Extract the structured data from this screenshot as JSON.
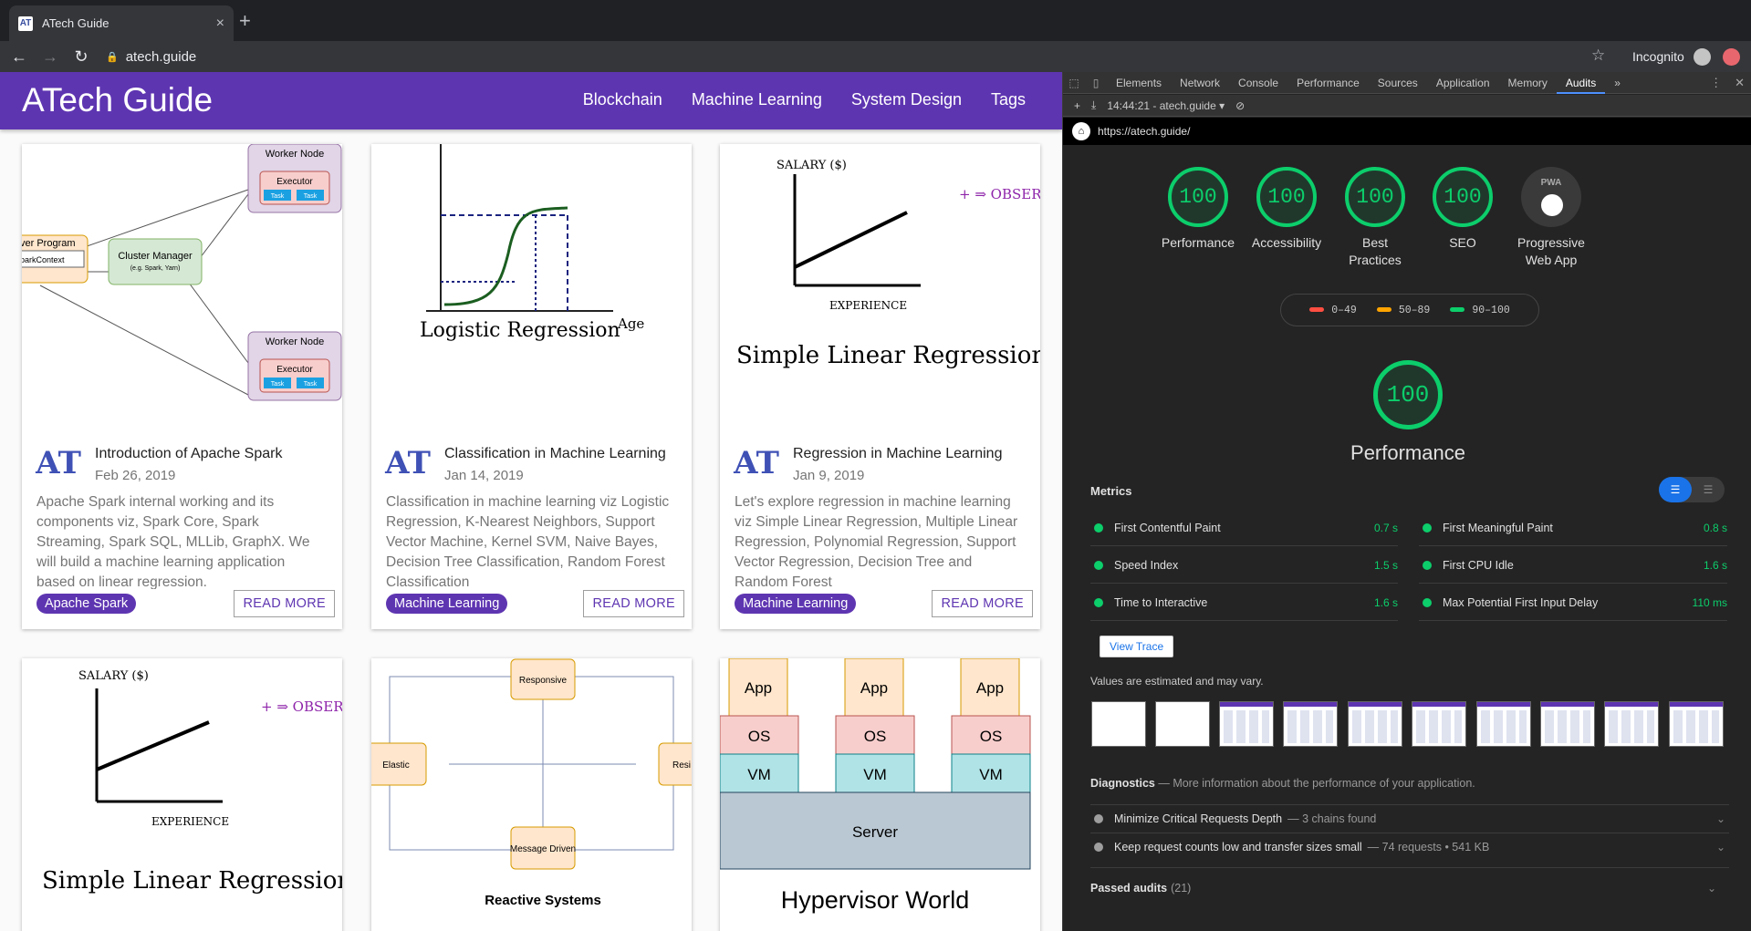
{
  "browser": {
    "tab_title": "ATech Guide",
    "tab_favicon": "AT",
    "close_glyph": "×",
    "newtab_glyph": "+",
    "url": "atech.guide",
    "profile_label": "Incognito",
    "lock_glyph": "🔒",
    "back_glyph": "←",
    "forward_glyph": "→",
    "reload_glyph": "↻",
    "star_glyph": "☆"
  },
  "site": {
    "brand": "ATech Guide",
    "nav": [
      "Blockchain",
      "Machine Learning",
      "System Design",
      "Tags"
    ],
    "logo_text": "AT",
    "cards": [
      {
        "image_title": "",
        "title": "Introduction of Apache Spark",
        "date": "Feb 26, 2019",
        "description": "Apache Spark internal working and its components viz, Spark Core, Spark Streaming, Spark SQL, MLLib, GraphX. We will build a machine learning application based on linear regression.",
        "tag": "Apache Spark",
        "more": "READ MORE",
        "diagram": {
          "worker_node": "Worker Node",
          "executor": "Executor",
          "task": "Task",
          "driver": "ver Program",
          "context": "parkContext",
          "cluster_manager": "Cluster Manager",
          "cluster_sub": "(e.g. Spark, Yarn)"
        }
      },
      {
        "image_title": "Logistic Regression",
        "title": "Classification in Machine Learning",
        "date": "Jan 14, 2019",
        "description": "Classification in machine learning viz Logistic Regression, K-Nearest Neighbors, Support Vector Machine, Kernel SVM, Naive Bayes, Decision Tree Classification, Random Forest Classification",
        "tag": "Machine Learning",
        "more": "READ MORE",
        "axis_label": "Age"
      },
      {
        "image_title": "Simple Linear Regression",
        "title": "Regression in Machine Learning",
        "date": "Jan 9, 2019",
        "description": "Let's explore regression in machine learning viz Simple Linear Regression, Multiple Linear Regression, Polynomial Regression, Support Vector Regression, Decision Tree and Random Forest",
        "tag": "Machine Learning",
        "more": "READ MORE",
        "y_label": "SALARY ($)",
        "x_label": "EXPERIENCE",
        "side_note": "+ ⇒ OBSERVA"
      },
      {
        "image_title": "Simple Linear Regression",
        "y_label": "SALARY ($)",
        "x_label": "EXPERIENCE",
        "side_note": "+ ⇒ OBSERVA"
      },
      {
        "image_title": "Reactive Systems",
        "nodes": [
          "Responsive",
          "Elastic",
          "Resi",
          "Message Driven"
        ]
      },
      {
        "image_title": "Hypervisor World",
        "app": "App",
        "os": "OS",
        "vm": "VM",
        "server": "Server"
      }
    ]
  },
  "devtools": {
    "tabs": [
      "Elements",
      "Network",
      "Console",
      "Performance",
      "Sources",
      "Application",
      "Memory",
      "Audits"
    ],
    "active_tab": "Audits",
    "overflow": "»",
    "report_selector": "14:44:21 - atech.guide ▾",
    "audited_url": "https://atech.guide/",
    "gauges": [
      {
        "score": "100",
        "label": "Performance"
      },
      {
        "score": "100",
        "label": "Accessibility"
      },
      {
        "score": "100",
        "label": "Best Practices"
      },
      {
        "score": "100",
        "label": "SEO"
      },
      {
        "score": "",
        "label": "Progressive Web App",
        "badge": "PWA"
      }
    ],
    "legend": [
      {
        "range": "0–49",
        "color": "#ff4e42"
      },
      {
        "range": "50–89",
        "color": "#ffa400"
      },
      {
        "range": "90–100",
        "color": "#0cce6b"
      }
    ],
    "category_score": "100",
    "category_title": "Performance",
    "metrics_heading": "Metrics",
    "metrics": [
      {
        "name": "First Contentful Paint",
        "value": "0.7 s"
      },
      {
        "name": "First Meaningful Paint",
        "value": "0.8 s"
      },
      {
        "name": "Speed Index",
        "value": "1.5 s"
      },
      {
        "name": "First CPU Idle",
        "value": "1.6 s"
      },
      {
        "name": "Time to Interactive",
        "value": "1.6 s"
      },
      {
        "name": "Max Potential First Input Delay",
        "value": "110 ms"
      }
    ],
    "view_trace": "View Trace",
    "estimate_note": "Values are estimated and may vary.",
    "diagnostics_title": "Diagnostics",
    "diagnostics_sub": "— More information about the performance of your application.",
    "audits": [
      {
        "name": "Minimize Critical Requests Depth",
        "detail": "— 3 chains found"
      },
      {
        "name": "Keep request counts low and transfer sizes small",
        "detail": "— 74 requests • 541 KB"
      }
    ],
    "passed_label": "Passed audits",
    "passed_count": "(21)",
    "pass_color": "#0cce6b"
  }
}
